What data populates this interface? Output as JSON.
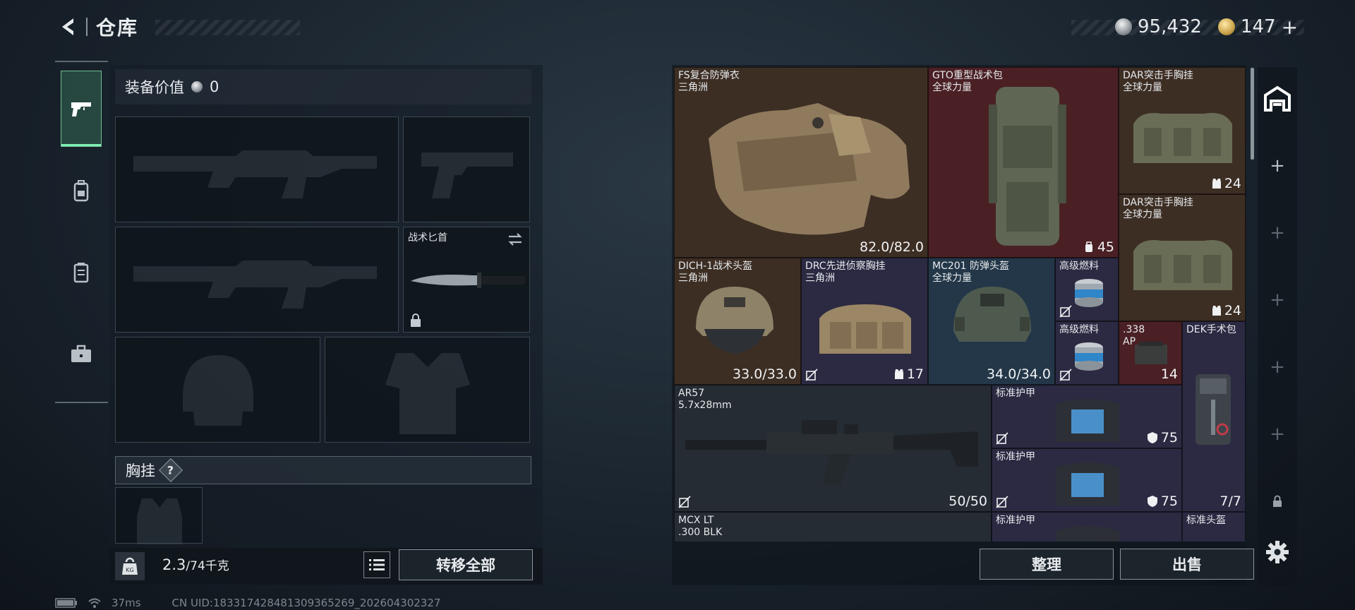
{
  "header": {
    "title": "仓库",
    "currency_silver": "95,432",
    "currency_gold": "147",
    "currency_gold_plus": "+"
  },
  "left": {
    "equipment_value_label": "装备价值",
    "equipment_value": "0",
    "knife_slot_label": "战术匕首",
    "chest_rig_label": "胸挂",
    "chest_help": "?",
    "weight_value": "2.3",
    "weight_max": "/74千克",
    "transfer_all_label": "转移全部"
  },
  "status": {
    "ping": "37ms",
    "uid": "CN UID:18331742848130936526​9_202604302327"
  },
  "stash": {
    "items": [
      {
        "name": "FS复合防弹衣",
        "sub": "三角洲",
        "value": "82.0/82.0"
      },
      {
        "name": "GTO重型战术包",
        "sub": "全球力量",
        "value": "45"
      },
      {
        "name": "DAR突击手胸挂",
        "sub": "全球力量",
        "value": "24"
      },
      {
        "name": "DAR突击手胸挂",
        "sub": "全球力量",
        "value": "24"
      },
      {
        "name": "DICH-1战术头盔",
        "sub": "三角洲",
        "value": "33.0/33.0"
      },
      {
        "name": "DRC先进侦察胸挂",
        "sub": "三角洲",
        "value": "17"
      },
      {
        "name": "MC201 防弹头盔",
        "sub": "全球力量",
        "value": "34.0/34.0"
      },
      {
        "name": "高级燃料",
        "sub": "",
        "value": ""
      },
      {
        "name": "高级燃料",
        "sub": "",
        "value": ""
      },
      {
        "name": ".338",
        "sub": "AP",
        "value": "14"
      },
      {
        "name": "DEK手术包",
        "sub": "",
        "value": "7/7"
      },
      {
        "name": "AR57",
        "sub": "5.7x28mm",
        "value": "50/50"
      },
      {
        "name": "标准护甲",
        "sub": "",
        "value": "75"
      },
      {
        "name": "标准护甲",
        "sub": "",
        "value": "75"
      },
      {
        "name": "MCX LT",
        "sub": ".300 BLK",
        "value": ""
      },
      {
        "name": "标准护甲",
        "sub": "",
        "value": ""
      },
      {
        "name": "标准头盔",
        "sub": "",
        "value": ""
      }
    ],
    "sort_label": "整理",
    "sell_label": "出售"
  },
  "colors": {
    "accent_green": "#7ff0b5",
    "rarity_red": "#4a2024",
    "rarity_purple": "#2b2a42",
    "rarity_blue": "#233748",
    "rarity_brown": "#3d2e24"
  }
}
